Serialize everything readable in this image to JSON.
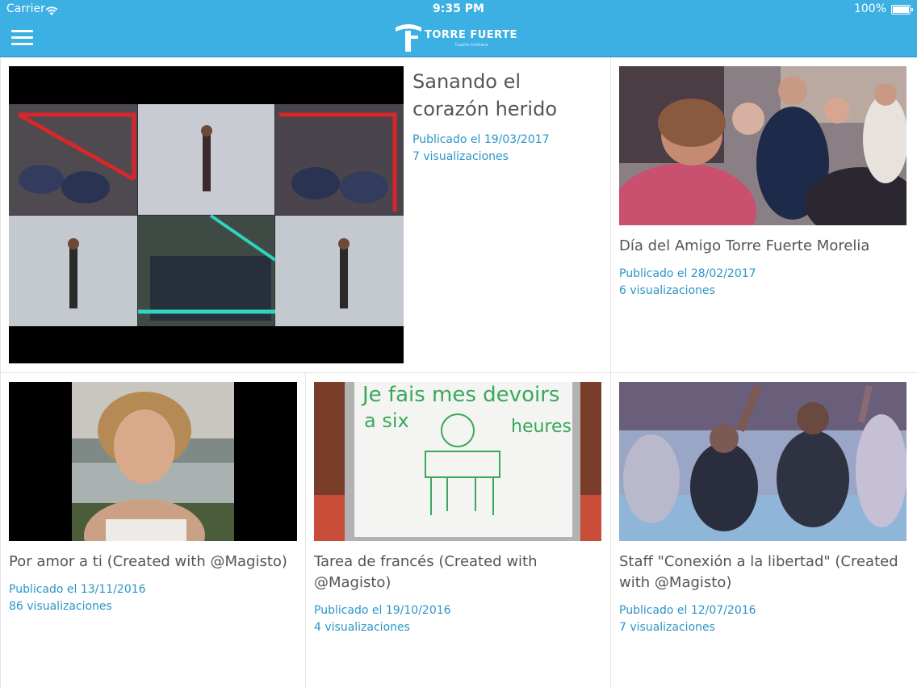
{
  "status_bar": {
    "carrier": "Carrier",
    "time": "9:35 PM",
    "battery": "100%"
  },
  "header": {
    "logo_text": "TORRE FUERTE",
    "logo_subtext": "Capilla Cristiana",
    "accent_color": "#3cb0e2"
  },
  "videos": [
    {
      "title": "Sanando el corazón herido",
      "published": "Publicado el 19/03/2017",
      "views": "7 visualizaciones"
    },
    {
      "title": "Día del Amigo Torre Fuerte Morelia",
      "published": "Publicado el 28/02/2017",
      "views": "6 visualizaciones"
    },
    {
      "title": "Por amor a ti  (Created with @Magisto)",
      "published": "Publicado el 13/11/2016",
      "views": "86 visualizaciones"
    },
    {
      "title": "Tarea de francés   (Created with @Magisto)",
      "published": "Publicado el 19/10/2016",
      "views": "4 visualizaciones"
    },
    {
      "title": "Staff \"Conexión a la libertad\"  (Created with @Magisto)",
      "published": "Publicado el 12/07/2016",
      "views": "7 visualizaciones"
    }
  ],
  "thumbnail_text": {
    "whiteboard_line1": "Je fais mes devoirs",
    "whiteboard_line2": "a six",
    "whiteboard_line3": "heures"
  }
}
